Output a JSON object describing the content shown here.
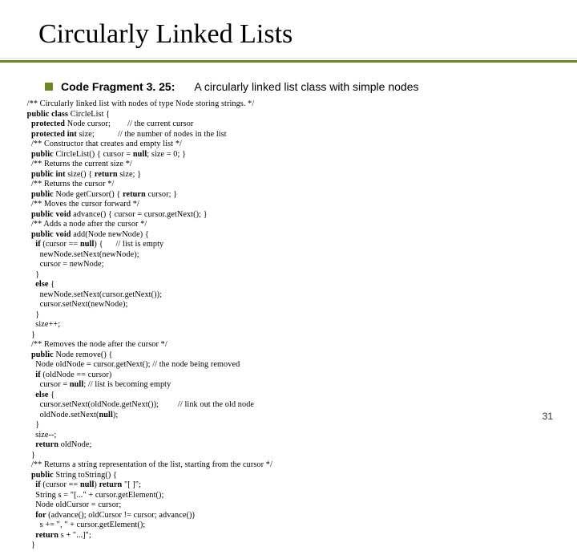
{
  "title": "Circularly Linked Lists",
  "bullet": {
    "label": "Code Fragment 3. 25:",
    "desc": "A circularly linked list class with simple nodes"
  },
  "code": {
    "l01": "/** Circularly linked list with nodes of type Node storing strings. */",
    "l02a": "public class ",
    "l02b": "CircleList {",
    "l03a": "  protected ",
    "l03b": "Node cursor;",
    "l03c": "        // the current cursor",
    "l04a": "  protected int ",
    "l04b": "size;",
    "l04c": "           // the number of nodes in the list",
    "l05": "  /** Constructor that creates and empty list */",
    "l06a": "  public ",
    "l06b": "CircleList() { cursor = ",
    "l06c": "null",
    "l06d": "; size = 0; }",
    "l07": "  /** Returns the current size */",
    "l08a": "  public int ",
    "l08b": "size() { ",
    "l08c": "return ",
    "l08d": "size; }",
    "l09": "  /** Returns the cursor */",
    "l10a": "  public ",
    "l10b": "Node getCursor() { ",
    "l10c": "return ",
    "l10d": "cursor; }",
    "l11": "  /** Moves the cursor forward */",
    "l12a": "  public void ",
    "l12b": "advance() { cursor = cursor.getNext(); }",
    "l13": "  /** Adds a node after the cursor */",
    "l14a": "  public void ",
    "l14b": "add(Node newNode) {",
    "l15a": "    if ",
    "l15b": "(cursor == ",
    "l15c": "null",
    "l15d": ") {      // list is empty",
    "l16": "      newNode.setNext(newNode);",
    "l17": "      cursor = newNode;",
    "l18": "    }",
    "l19a": "    else ",
    "l19b": "{",
    "l20": "      newNode.setNext(cursor.getNext());",
    "l21": "      cursor.setNext(newNode);",
    "l22": "    }",
    "l23": "    size++;",
    "l24": "  }",
    "l25": "  /** Removes the node after the cursor */",
    "l26a": "  public ",
    "l26b": "Node remove() {",
    "l27": "    Node oldNode = cursor.getNext(); // the node being removed",
    "l28a": "    if ",
    "l28b": "(oldNode == cursor)",
    "l29a": "      cursor = ",
    "l29b": "null",
    "l29c": "; // list is becoming empty",
    "l30a": "    else ",
    "l30b": "{",
    "l31": "      cursor.setNext(oldNode.getNext());         // link out the old node",
    "l32a": "      oldNode.setNext(",
    "l32b": "null",
    "l32c": ");",
    "l33": "    }",
    "l34": "    size--;",
    "l35a": "    return ",
    "l35b": "oldNode;",
    "l36": "  }",
    "l37": "  /** Returns a string representation of the list, starting from the cursor */",
    "l38a": "  public ",
    "l38b": "String toString() {",
    "l39a": "    if ",
    "l39b": "(cursor == ",
    "l39c": "null",
    "l39d": ") ",
    "l39e": "return ",
    "l39f": "\"[ ]\";",
    "l40": "    String s = \"[...\" + cursor.getElement();",
    "l41": "    Node oldCursor = cursor;",
    "l42a": "    for ",
    "l42b": "(advance(); oldCursor != cursor; advance())",
    "l43": "      s += \", \" + cursor.getElement();",
    "l44a": "    return ",
    "l44b": "s + \"...]\";",
    "l45": "  }"
  },
  "page_number": "31"
}
